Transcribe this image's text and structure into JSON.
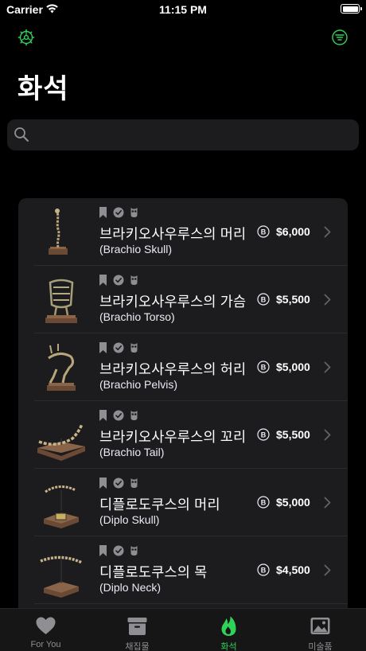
{
  "status_bar": {
    "carrier": "Carrier",
    "time": "11:15 PM"
  },
  "header": {
    "title": "화석"
  },
  "search": {
    "placeholder": ""
  },
  "colors": {
    "accent": "#30d158",
    "background": "#000000",
    "card": "#1c1c1e"
  },
  "fossils": [
    {
      "name": "브라키오사우루스의 머리",
      "subname": "(Brachio Skull)",
      "price": "$6,000"
    },
    {
      "name": "브라키오사우루스의 가슴",
      "subname": "(Brachio Torso)",
      "price": "$5,500"
    },
    {
      "name": "브라키오사우루스의 허리",
      "subname": "(Brachio Pelvis)",
      "price": "$5,000"
    },
    {
      "name": "브라키오사우루스의 꼬리",
      "subname": "(Brachio Tail)",
      "price": "$5,500"
    },
    {
      "name": "디플로도쿠스의 머리",
      "subname": "(Diplo Skull)",
      "price": "$5,000"
    },
    {
      "name": "디플로도쿠스의 목",
      "subname": "(Diplo Neck)",
      "price": "$4,500"
    }
  ],
  "tabs": [
    {
      "label": "For You",
      "icon": "heart-icon"
    },
    {
      "label": "채집물",
      "icon": "archive-box-icon"
    },
    {
      "label": "화석",
      "icon": "flame-icon",
      "active": true
    },
    {
      "label": "미술품",
      "icon": "picture-icon"
    }
  ]
}
